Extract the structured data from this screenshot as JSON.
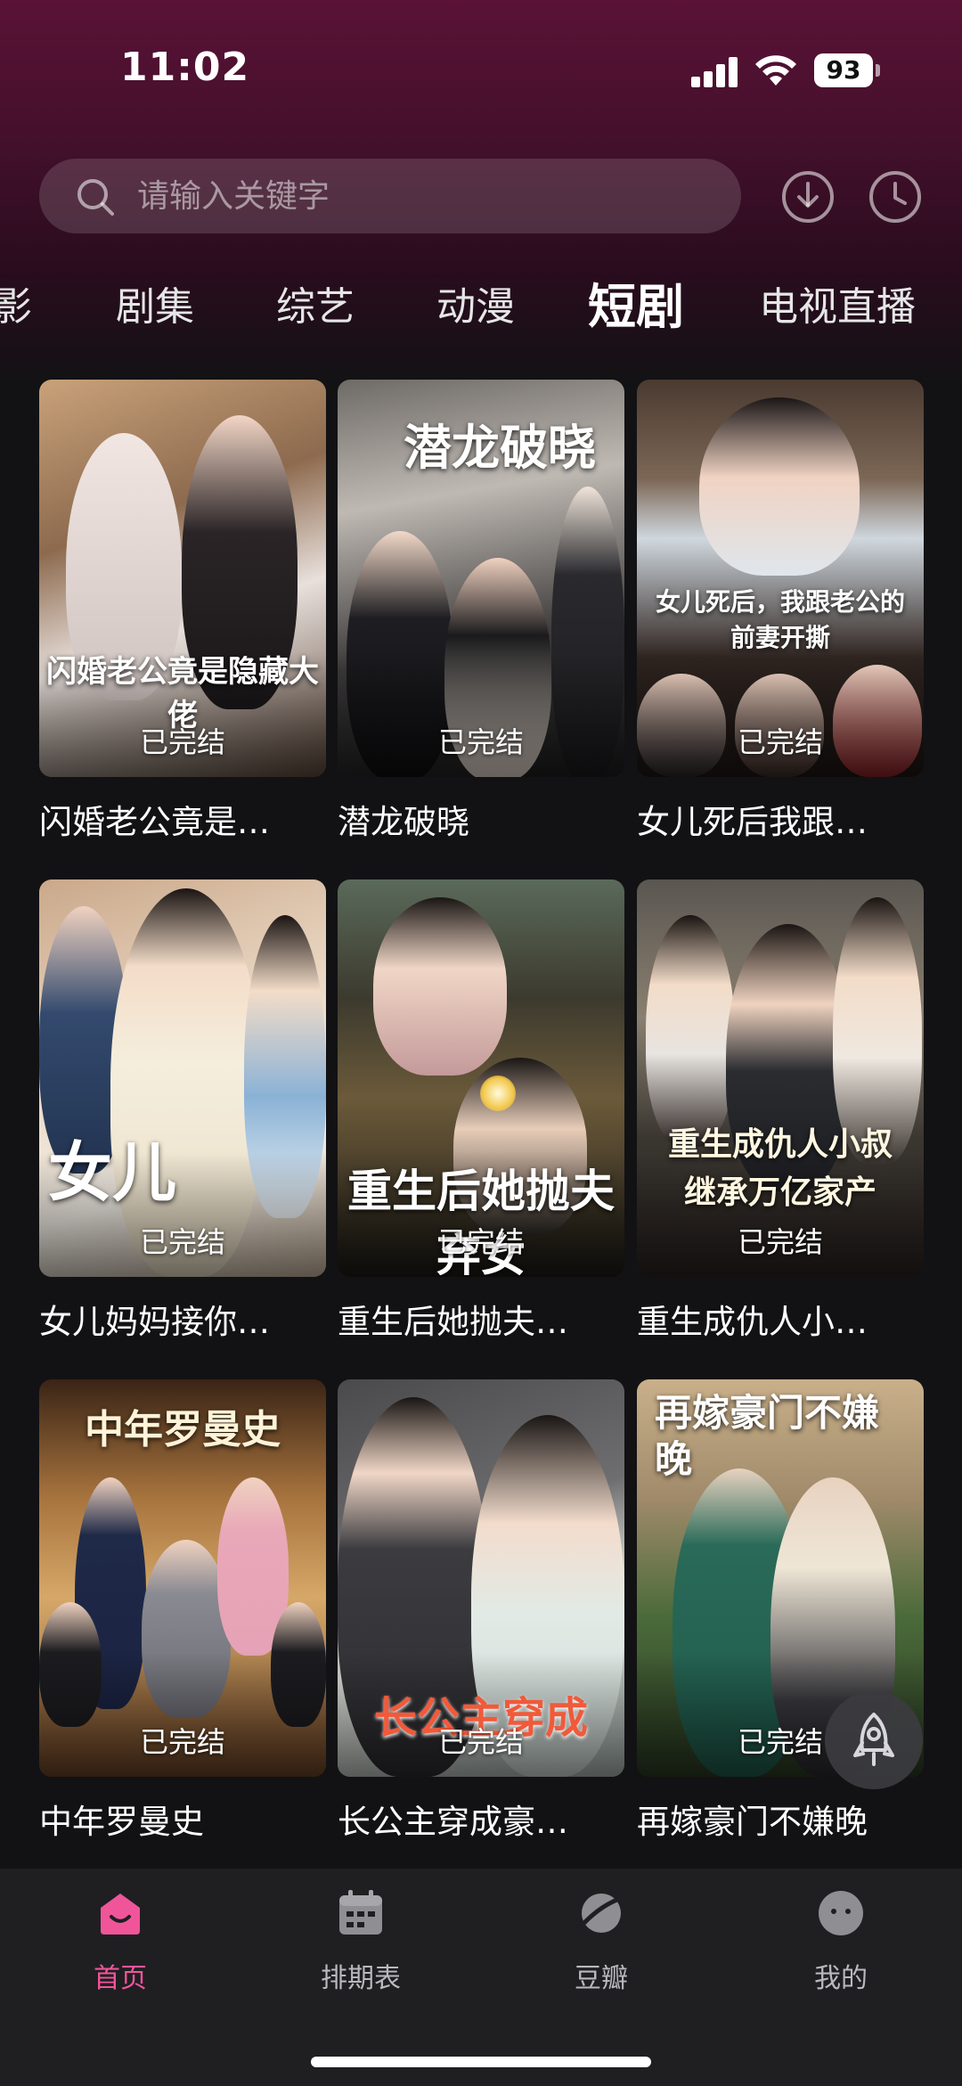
{
  "status_bar": {
    "time": "11:02",
    "battery": "93"
  },
  "search": {
    "placeholder": "请输入关键字"
  },
  "category_tabs": [
    {
      "label": "影"
    },
    {
      "label": "剧集"
    },
    {
      "label": "综艺"
    },
    {
      "label": "动漫"
    },
    {
      "label": "短剧",
      "active": true
    },
    {
      "label": "电视直播"
    }
  ],
  "cards": [
    {
      "title": "闪婚老公竟是…",
      "status": "已完结",
      "poster_text": "闪婚老公竟是隐藏大佬"
    },
    {
      "title": "潜龙破晓",
      "status": "已完结",
      "poster_text": "潜龙破晓"
    },
    {
      "title": "女儿死后我跟…",
      "status": "已完结",
      "poster_text": "女儿死后，我跟老公的前妻开撕"
    },
    {
      "title": "女儿妈妈接你…",
      "status": "已完结",
      "poster_text": "女儿"
    },
    {
      "title": "重生后她抛夫…",
      "status": "已完结",
      "poster_text": "重生后她抛夫弃女"
    },
    {
      "title": "重生成仇人小…",
      "status": "已完结",
      "poster_text": "重生成仇人小叔继承万亿家产"
    },
    {
      "title": "中年罗曼史",
      "status": "已完结",
      "poster_text": "中年罗曼史"
    },
    {
      "title": "长公主穿成豪…",
      "status": "已完结",
      "poster_text": "长公主穿成"
    },
    {
      "title": "再嫁豪门不嫌晚",
      "status": "已完结",
      "poster_text": "再嫁豪门不嫌晚"
    }
  ],
  "bottom_nav": [
    {
      "label": "首页",
      "icon": "home-icon",
      "active": true
    },
    {
      "label": "排期表",
      "icon": "calendar-icon"
    },
    {
      "label": "豆瓣",
      "icon": "planet-icon"
    },
    {
      "label": "我的",
      "icon": "profile-face-icon"
    }
  ],
  "colors": {
    "accent": "#f0559a",
    "header_top": "#5a1236",
    "background": "#121214",
    "nav_background": "#1f1f22"
  }
}
